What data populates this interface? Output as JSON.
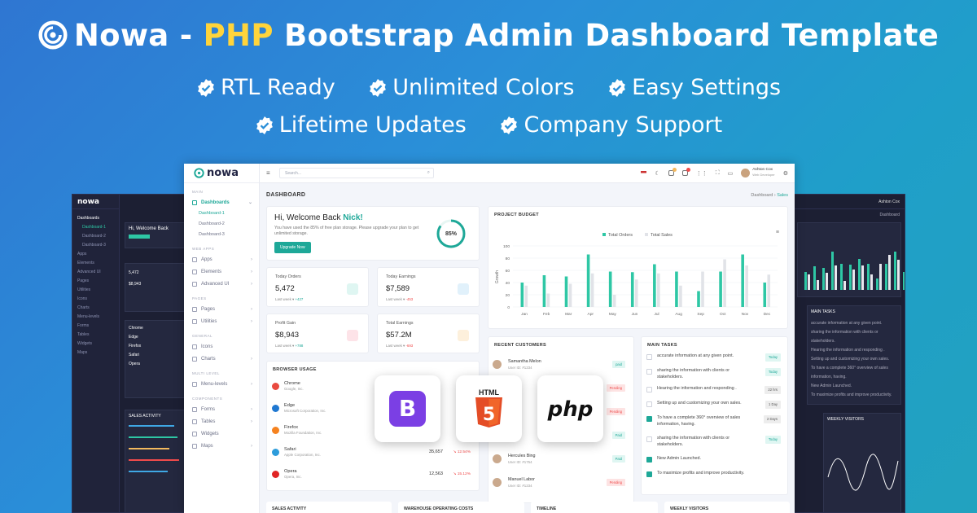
{
  "hero": {
    "brand": "Nowa",
    "dash": "-",
    "accent": "PHP",
    "rest": "Bootstrap Admin Dashboard Template"
  },
  "features_row1": [
    "RTL Ready",
    "Unlimited Colors",
    "Easy Settings"
  ],
  "features_row2": [
    "Lifetime Updates",
    "Company Support"
  ],
  "colors": {
    "accent": "#1ea898",
    "title_highlight": "#ffd43b",
    "danger": "#f04b4b",
    "warning": "#f3b95e",
    "info": "#3fa8e5"
  },
  "app": {
    "logo": "nowa",
    "search_placeholder": "Search...",
    "user_name": "Ashton Cox",
    "user_role": "Web Developer",
    "page_title": "DASHBOARD",
    "breadcrumb_root": "Dashboard",
    "breadcrumb_current": "Sales",
    "sidebar": {
      "sec_main": "MAIN",
      "dashboard": "Dashboards",
      "subs": [
        "Dashboard-1",
        "Dashboard-2",
        "Dashboard-3"
      ],
      "sec_webapps": "WEB APPS",
      "apps": "Apps",
      "elements": "Elements",
      "advanced": "Advanced UI",
      "sec_pages": "PAGES",
      "pages": "Pages",
      "utilities": "Utilities",
      "sec_general": "GENERAL",
      "icons": "Icons",
      "charts": "Charts",
      "sec_multi": "MULTI LEVEL",
      "menu_levels": "Menu-levels",
      "sec_components": "COMPONENTS",
      "forms": "Forms",
      "tables": "Tables",
      "widgets": "Widgets",
      "maps": "Maps"
    },
    "welcome": {
      "greeting": "Hi, Welcome Back",
      "name": "Nick!",
      "text": "You have used the 85% of free plan storage. Please upgrade your plan to get unlimited storage.",
      "button": "Upgrade Now",
      "progress_label": "85%",
      "progress": 0.85
    },
    "stats": [
      {
        "label": "Today Orders",
        "value": "5,472",
        "period": "Last week",
        "change": "+427",
        "dir": "up",
        "icon_color": "#1ea898"
      },
      {
        "label": "Today Earnings",
        "value": "$7,589",
        "period": "Last week",
        "change": "-453",
        "dir": "down",
        "icon_color": "#3fa8e5"
      },
      {
        "label": "Profit Gain",
        "value": "$8,943",
        "period": "Last week",
        "change": "+788",
        "dir": "up",
        "icon_color": "#f04b4b"
      },
      {
        "label": "Total Earnings",
        "value": "$57.2M",
        "period": "Last week",
        "change": "-693",
        "dir": "down",
        "icon_color": "#f3b95e"
      }
    ],
    "project_budget": "PROJECT BUDGET",
    "browser_usage": {
      "title": "BROWSER USAGE",
      "rows": [
        {
          "name": "Chrome",
          "company": "Google, Inc.",
          "value": "",
          "pct": "",
          "color": "#e94a3f"
        },
        {
          "name": "Edge",
          "company": "Microsoft Corporation, Inc.",
          "value": "",
          "pct": "",
          "color": "#1f78d1"
        },
        {
          "name": "Firefox",
          "company": "Mozilla Foundation, Inc.",
          "value": "",
          "pct": "",
          "color": "#f5821f"
        },
        {
          "name": "Safari",
          "company": "Apple Corporation, Inc.",
          "value": "35,657",
          "pct": "12.54%",
          "color": "#2d9cdb"
        },
        {
          "name": "Opera",
          "company": "Opera, Inc.",
          "value": "12,563",
          "pct": "15.12%",
          "color": "#e02424"
        }
      ]
    },
    "recent_customers": {
      "title": "RECENT CUSTOMERS",
      "rows": [
        {
          "name": "Samantha Melon",
          "id": "User ID: #1234",
          "status": "paid",
          "kind": "paid"
        },
        {
          "name": "",
          "id": "",
          "status": "Pending",
          "kind": "pending"
        },
        {
          "name": "",
          "id": "",
          "status": "Pending",
          "kind": "pending"
        },
        {
          "name": "",
          "id": "",
          "status": "Paid",
          "kind": "paid"
        },
        {
          "name": "Hercules Bing",
          "id": "User ID: #1754",
          "status": "Paid",
          "kind": "paid"
        },
        {
          "name": "Manuel Labor",
          "id": "User ID: #1234",
          "status": "Pending",
          "kind": "pending"
        }
      ]
    },
    "main_tasks": {
      "title": "MAIN TASKS",
      "rows": [
        {
          "text": "accurate information at any given point.",
          "badge": "Today",
          "done": false
        },
        {
          "text": "sharing the information with clients or stakeholders.",
          "badge": "Today",
          "done": false
        },
        {
          "text": "Hearing the information and responding .",
          "badge": "22 hrs",
          "done": false
        },
        {
          "text": "Setting up and customizing your own sales.",
          "badge": "1 Day",
          "done": false
        },
        {
          "text": "To have a complete 360° overview of sales information, having.",
          "badge": "2 Days",
          "done": true
        },
        {
          "text": "sharing the information with clients or stakeholders.",
          "badge": "Today",
          "done": false
        },
        {
          "text": "New Admin Launched.",
          "badge": "",
          "done": true
        },
        {
          "text": "To maximize profits and improve productivity.",
          "badge": "",
          "done": true
        }
      ]
    },
    "bottom": [
      "SALES ACTIVITY",
      "WAREHOUSE OPERATING COSTS",
      "TIMELINE",
      "WEEKLY VISITORS"
    ]
  },
  "tech_logos": [
    {
      "name": "Bootstrap",
      "glyph": "B"
    },
    {
      "name": "HTML5",
      "label": "HTML",
      "glyph": "5"
    },
    {
      "name": "PHP",
      "label": "php"
    }
  ],
  "chart_data": {
    "type": "bar",
    "categories": [
      "Jan",
      "Feb",
      "Mar",
      "Apr",
      "May",
      "Jun",
      "Jul",
      "Aug",
      "Sep",
      "Oct",
      "Nov",
      "Dec"
    ],
    "series": [
      {
        "name": "Total Orders",
        "color": "#2ec7a5",
        "values": [
          40,
          52,
          50,
          86,
          58,
          57,
          70,
          58,
          26,
          58,
          86,
          40
        ]
      },
      {
        "name": "Total Sales",
        "color": "#e1e3e8",
        "values": [
          35,
          22,
          38,
          55,
          20,
          45,
          55,
          35,
          58,
          78,
          68,
          53
        ]
      }
    ],
    "ylabel": "Growth",
    "yticks": [
      0,
      20,
      40,
      60,
      80,
      100
    ],
    "ylim": [
      0,
      100
    ],
    "legend": "top-center"
  }
}
